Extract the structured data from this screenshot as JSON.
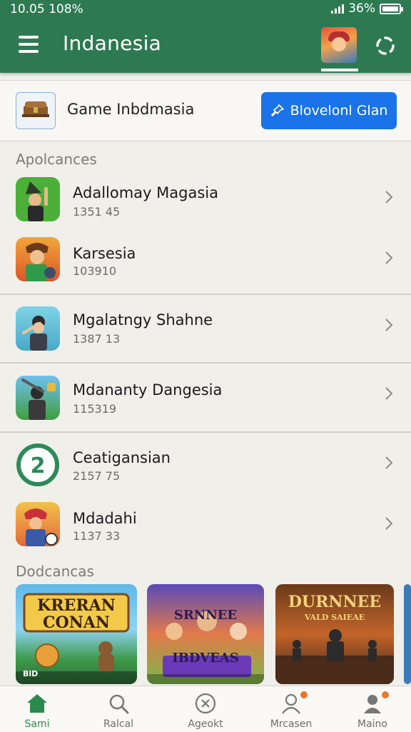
{
  "status": {
    "time": "10.05 108%",
    "battery": "36%"
  },
  "header": {
    "title": "Indanesia",
    "menu_icon": "hamburger-menu-icon",
    "settings_icon": "settings-loader-icon"
  },
  "featured": {
    "title": "Game Inbdmasia",
    "button_label": "Blovelonl Glan",
    "button_icon": "pin-icon"
  },
  "sections": {
    "apps_title": "Apolcances",
    "cards_title": "Dodcancas"
  },
  "apps": [
    {
      "title": "Adallomay Magasia",
      "subtitle": "1351 45"
    },
    {
      "title": "Karsesia",
      "subtitle": "103910"
    },
    {
      "title": "Mgalatngy Shahne",
      "subtitle": "1387 13"
    },
    {
      "title": "Mdananty Dangesia",
      "subtitle": "115319"
    },
    {
      "title": "Ceatigansian",
      "subtitle": "2157 75",
      "icon_text": "2"
    },
    {
      "title": "Mdadahi",
      "subtitle": "1137 33"
    }
  ],
  "cards": [
    {
      "title": "KRERAN CONAN",
      "tag": "BlD"
    },
    {
      "title": "SRNNEE IBDVEAS",
      "tag": ""
    },
    {
      "title": "DURNNEE",
      "subtitle": "VALD SAIEAE",
      "tag": ""
    }
  ],
  "nav": [
    {
      "label": "Sami",
      "icon": "home-icon",
      "active": true
    },
    {
      "label": "Ralcal",
      "icon": "search-icon"
    },
    {
      "label": "Ageokt",
      "icon": "close-circle-icon"
    },
    {
      "label": "Mrcasen",
      "icon": "profile-icon",
      "badge": true
    },
    {
      "label": "Maino",
      "icon": "account-icon",
      "badge": true
    }
  ],
  "colors": {
    "header": "#2d7a52",
    "accent_blue": "#1a73e8",
    "active_green": "#2d8a4e",
    "badge": "#e9752a"
  }
}
